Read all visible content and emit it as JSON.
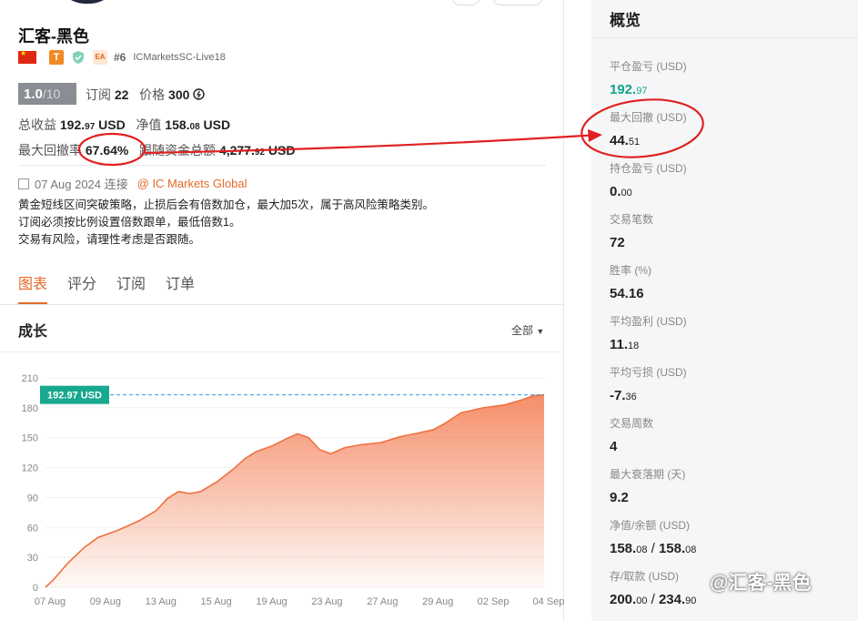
{
  "trader": {
    "name": "汇客-黑色",
    "rank": "#6",
    "server": "ICMarketsSC-Live18",
    "badges": {
      "t": "T",
      "ea": "EA"
    },
    "score": "1.0",
    "score_out": "/10",
    "subs_label": "订阅",
    "subs_count": "22",
    "price_label": "价格",
    "price_value": "300",
    "total_profit_label": "总收益",
    "total_profit_int": "192.",
    "total_profit_dec": "97",
    "total_profit_unit": "USD",
    "net_label": "净值",
    "net_int": "158.",
    "net_dec": "08",
    "net_unit": "USD",
    "dd_label": "最大回撤率",
    "dd_value": "67.64%",
    "follow_label": "跟随资金总额",
    "follow_int": "4,277.",
    "follow_dec": "92",
    "follow_unit": "USD",
    "connect_date": "07 Aug 2024 连接",
    "broker": "@ IC Markets Global",
    "description": [
      "黄金短线区间突破策略，止损后会有倍数加仓，最大加5次，属于高风险策略类别。",
      "订阅必须按比例设置倍数跟单，最低倍数1。",
      "交易有风险，请理性考虑是否跟随。"
    ]
  },
  "tabs": [
    "图表",
    "评分",
    "订阅",
    "订单"
  ],
  "growth": {
    "title": "成长",
    "range_label": "全部",
    "current_tag": "192.97 USD"
  },
  "chart_data": {
    "type": "area",
    "x": [
      "07 Aug",
      "09 Aug",
      "13 Aug",
      "15 Aug",
      "19 Aug",
      "23 Aug",
      "27 Aug",
      "29 Aug",
      "02 Sep",
      "04 Sep"
    ],
    "y_ticks": [
      0,
      30,
      60,
      90,
      120,
      150,
      180,
      210
    ],
    "ylim": [
      0,
      210
    ],
    "series": [
      {
        "points": [
          [
            0,
            0
          ],
          [
            0.15,
            8
          ],
          [
            0.4,
            24
          ],
          [
            0.7,
            40
          ],
          [
            0.95,
            50
          ],
          [
            1.3,
            57
          ],
          [
            1.7,
            67
          ],
          [
            2.0,
            77
          ],
          [
            2.2,
            89
          ],
          [
            2.4,
            96
          ],
          [
            2.6,
            94
          ],
          [
            2.8,
            96
          ],
          [
            3.1,
            106
          ],
          [
            3.4,
            119
          ],
          [
            3.6,
            129
          ],
          [
            3.8,
            136
          ],
          [
            4.1,
            142
          ],
          [
            4.35,
            149
          ],
          [
            4.55,
            154
          ],
          [
            4.75,
            150
          ],
          [
            4.95,
            138
          ],
          [
            5.15,
            134
          ],
          [
            5.4,
            140
          ],
          [
            5.7,
            143
          ],
          [
            6.05,
            145
          ],
          [
            6.4,
            151
          ],
          [
            6.75,
            155
          ],
          [
            7.0,
            158
          ],
          [
            7.2,
            164
          ],
          [
            7.5,
            175
          ],
          [
            7.9,
            180
          ],
          [
            8.3,
            183
          ],
          [
            8.6,
            188
          ],
          [
            8.8,
            192
          ],
          [
            9.0,
            192.97
          ]
        ]
      }
    ],
    "reference_line": 192.97,
    "area_color": "#f47b50",
    "line_color": "#f07040",
    "ref_color": "#2a9fd6",
    "tag_color": "#17a88f"
  },
  "overview": {
    "title": "概览",
    "stats": [
      {
        "label": "平仓盈亏 (USD)",
        "int": "192.",
        "dec": "97",
        "green": true
      },
      {
        "label": "最大回撤 (USD)",
        "int": "44.",
        "dec": "51",
        "green": false
      },
      {
        "label": "持仓盈亏 (USD)",
        "int": "0.",
        "dec": "00",
        "green": false
      },
      {
        "label": "交易笔数",
        "int": "72",
        "dec": "",
        "green": false
      },
      {
        "label": "胜率 (%)",
        "int": "54.16",
        "dec": "",
        "green": false
      },
      {
        "label": "平均盈利 (USD)",
        "int": "11.",
        "dec": "18",
        "green": false
      },
      {
        "label": "平均亏损 (USD)",
        "int": "-7.",
        "dec": "36",
        "green": false
      },
      {
        "label": "交易周数",
        "int": "4",
        "dec": "",
        "green": false
      },
      {
        "label": "最大衰落期 (天)",
        "int": "9.2",
        "dec": "",
        "green": false
      },
      {
        "label": "净值/余额 (USD)",
        "int": "158.",
        "dec": "08",
        "int2": "158.",
        "dec2": "08",
        "green": false
      },
      {
        "label": "存/取款 (USD)",
        "int": "200.",
        "dec": "00",
        "int2": "234.",
        "dec2": "90",
        "green": false
      }
    ]
  },
  "watermark": "@汇客-黑色",
  "colors": {
    "accent": "#e36a2a",
    "green": "#12a38a",
    "annotation": "#e02020"
  }
}
